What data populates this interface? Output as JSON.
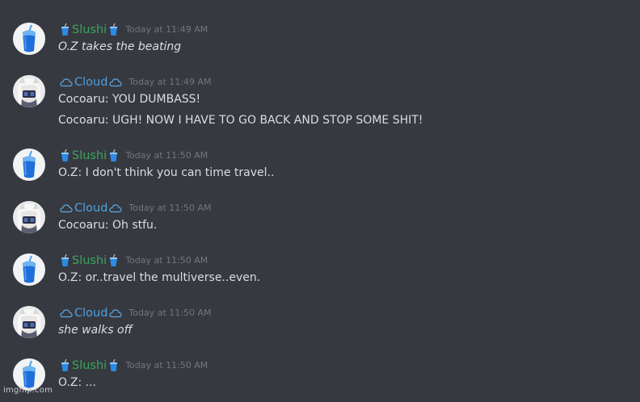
{
  "timestamps": {
    "t1149": "Today at 11:49 AM",
    "t1150": "Today at 11:50 AM"
  },
  "users": {
    "slushi": {
      "name": "Slushi",
      "color": "#3ba55c",
      "emoji": "cup-with-straw-icon"
    },
    "cloud": {
      "name": "Cloud",
      "color": "#4ea0e0",
      "emoji": "cloud-icon"
    }
  },
  "messages": [
    {
      "author": "Slushi",
      "time": "Today at 11:49 AM",
      "lines": [
        "O.Z takes the beating"
      ]
    },
    {
      "author": "Cloud",
      "time": "Today at 11:49 AM",
      "lines": [
        "Cocoaru: YOU DUMBASS!",
        "Cocoaru: UGH! NOW I HAVE TO GO BACK AND STOP SOME SHIT!"
      ]
    },
    {
      "author": "Slushi",
      "time": "Today at 11:50 AM",
      "lines": [
        "O.Z: I don't think you can time travel.."
      ]
    },
    {
      "author": "Cloud",
      "time": "Today at 11:50 AM",
      "lines": [
        "Cocoaru:  Oh stfu."
      ]
    },
    {
      "author": "Slushi",
      "time": "Today at 11:50 AM",
      "lines": [
        "O.Z: or..travel the multiverse..even."
      ]
    },
    {
      "author": "Cloud",
      "time": "Today at 11:50 AM",
      "lines": [
        "she walks off"
      ]
    },
    {
      "author": "Slushi",
      "time": "Today at 11:50 AM",
      "lines": [
        "O.Z: ..."
      ]
    }
  ],
  "watermark": "imgflip.com"
}
